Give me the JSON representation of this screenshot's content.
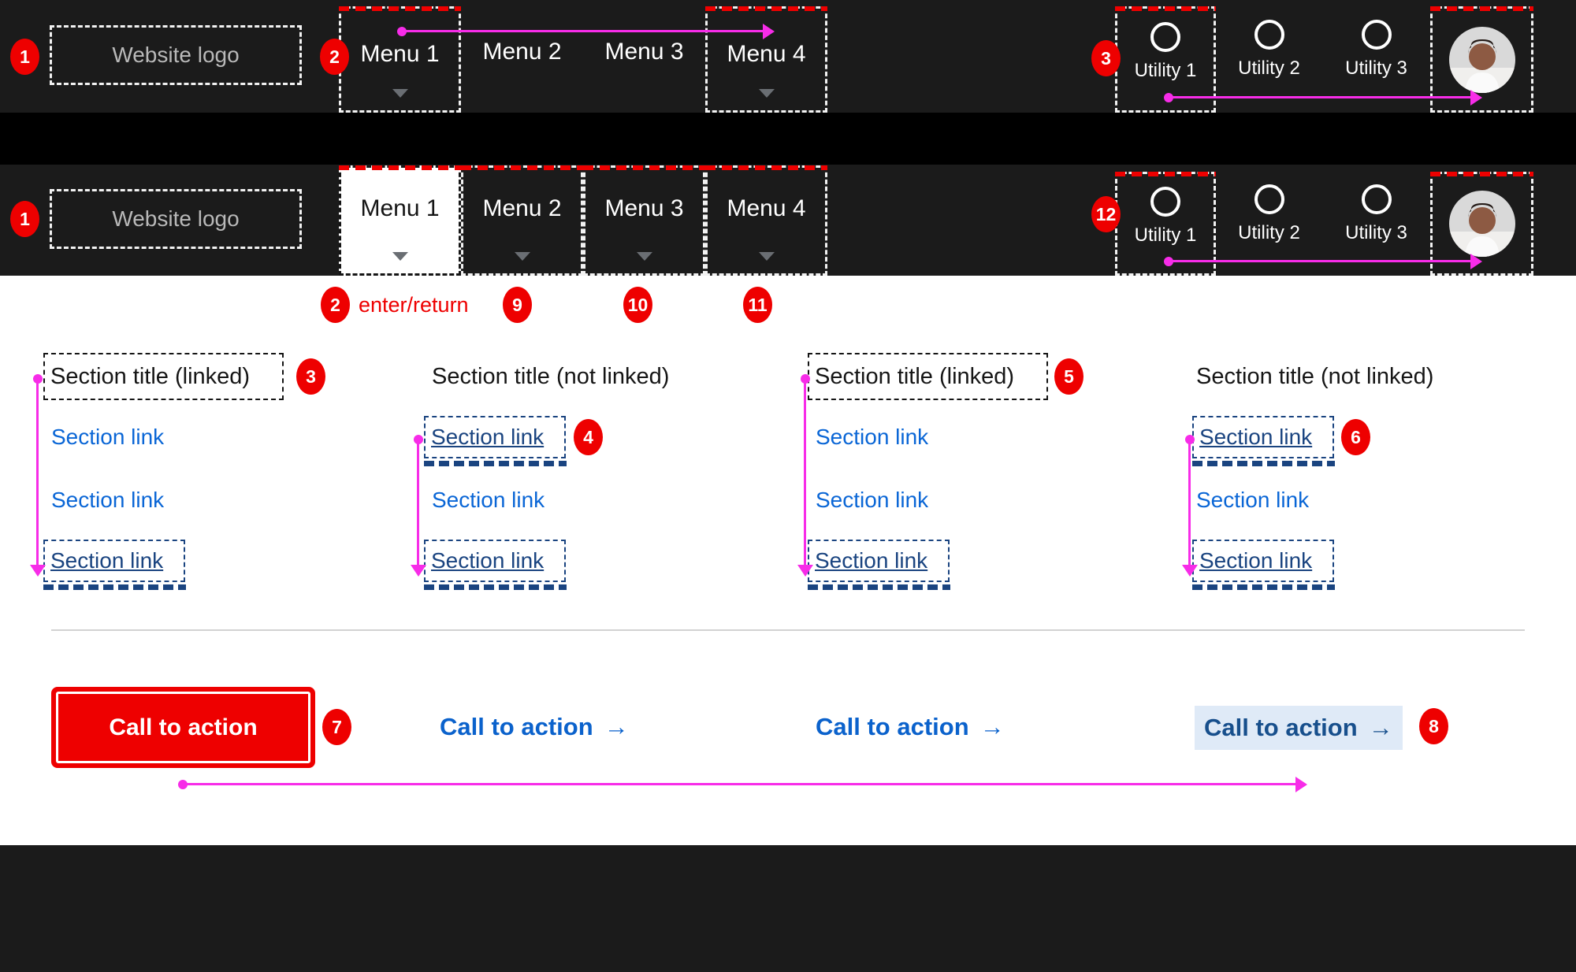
{
  "colors": {
    "bar_bg": "#1b1b1b",
    "gap_bg": "#000000",
    "panel_bg": "#ffffff",
    "focus_red": "#ee0000",
    "annotation_magenta": "#f72ce8",
    "link_blue": "#0a66d6",
    "focus_navy": "#1a4480",
    "cta_highlight_bg": "#dfeaf7",
    "cta_highlight_text": "#174f8c",
    "logo_text": "#b9b9b9",
    "divider": "#d2d2d2"
  },
  "glyphs": {
    "arrow_right": "→"
  },
  "nav": {
    "logo_label": "Website logo",
    "menus": [
      "Menu 1",
      "Menu 2",
      "Menu 3",
      "Menu 4"
    ],
    "utilities": [
      "Utility 1",
      "Utility 2",
      "Utility 3"
    ]
  },
  "annotations": {
    "logo_badge": "1",
    "menu_focus_badge": "2",
    "utility_focus_badge": "3",
    "expanded_logo_badge": "1",
    "expanded_utility_badge": "12",
    "enter_badge": "2",
    "enter_hint": "enter/return",
    "menu2_badge": "9",
    "menu3_badge": "10",
    "menu4_badge": "11",
    "title_col1_badge": "3",
    "link_col2_badge": "4",
    "title_col3_badge": "5",
    "link_col4_badge": "6",
    "cta_button_badge": "7",
    "cta_link_badge": "8"
  },
  "mega": {
    "columns": [
      {
        "title": "Section title (linked)",
        "links": [
          "Section link",
          "Section link",
          "Section link"
        ]
      },
      {
        "title": "Section title (not linked)",
        "links": [
          "Section link",
          "Section link",
          "Section link"
        ]
      },
      {
        "title": "Section title (linked)",
        "links": [
          "Section link",
          "Section link",
          "Section link"
        ]
      },
      {
        "title": "Section title (not linked)",
        "links": [
          "Section link",
          "Section link",
          "Section link"
        ]
      }
    ]
  },
  "cta": {
    "button_label": "Call to action",
    "link_labels": [
      "Call to action",
      "Call to action",
      "Call to action"
    ]
  }
}
